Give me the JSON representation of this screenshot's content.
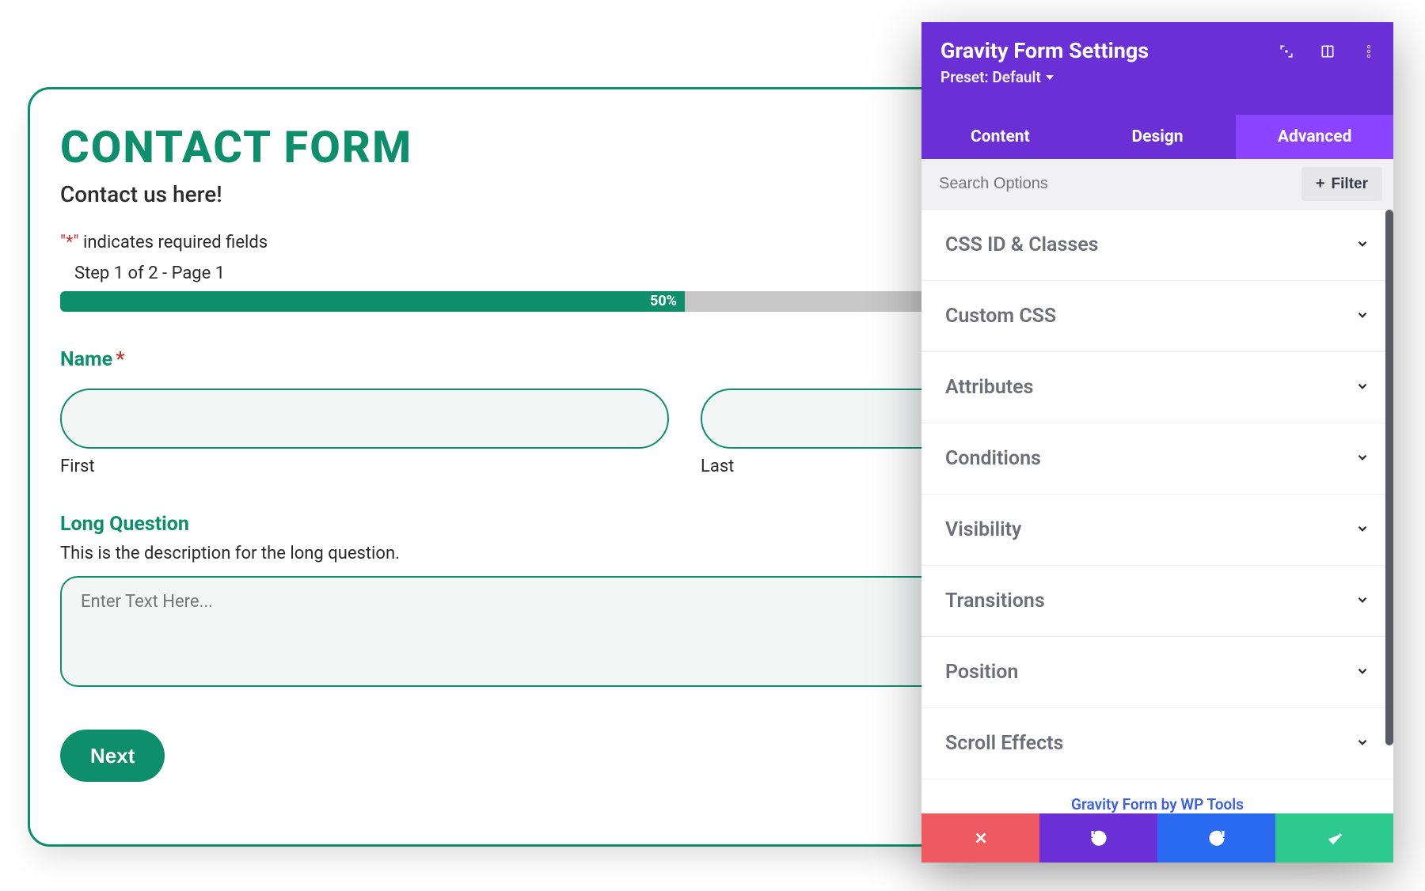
{
  "form": {
    "title": "CONTACT FORM",
    "subtitle": "Contact us here!",
    "required_note_prefix": "\"",
    "required_note_star": "*",
    "required_note_suffix": "\" indicates required fields",
    "step_note": "Step 1 of 2 - Page 1",
    "progress_pct": "50%",
    "name": {
      "label": "Name",
      "required_mark": "*",
      "first_sub": "First",
      "last_sub": "Last"
    },
    "long_question": {
      "label": "Long Question",
      "description": "This is the description for the long question.",
      "placeholder": "Enter Text Here..."
    },
    "next_label": "Next"
  },
  "panel": {
    "title": "Gravity Form Settings",
    "preset_label": "Preset: Default",
    "tabs": {
      "content": "Content",
      "design": "Design",
      "advanced": "Advanced",
      "active": "advanced"
    },
    "search_placeholder": "Search Options",
    "filter_label": "Filter",
    "sections": [
      "CSS ID & Classes",
      "Custom CSS",
      "Attributes",
      "Conditions",
      "Visibility",
      "Transitions",
      "Position",
      "Scroll Effects"
    ],
    "credit": "Gravity Form by WP Tools"
  },
  "colors": {
    "accent_green": "#0e8f6b",
    "purple": "#6b2fd6",
    "purple_light": "#8b43ff"
  }
}
